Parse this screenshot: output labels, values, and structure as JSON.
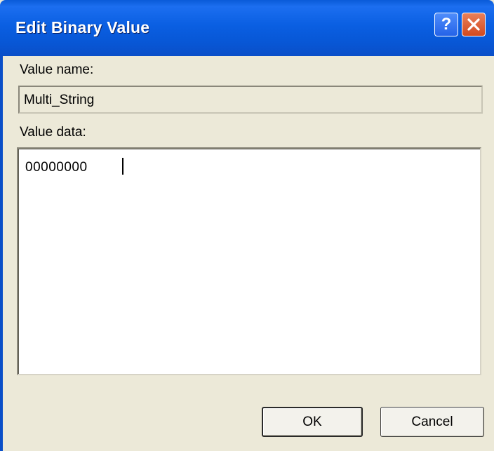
{
  "window": {
    "title": "Edit Binary Value",
    "help_glyph": "?",
    "accent_color": "#0A5FE2",
    "close_color": "#D24A20"
  },
  "fields": {
    "value_name_label": "Value name:",
    "value_name": "Multi_String",
    "value_data_label": "Value data:",
    "value_data_offset": "00000000"
  },
  "buttons": {
    "ok": "OK",
    "cancel": "Cancel"
  }
}
